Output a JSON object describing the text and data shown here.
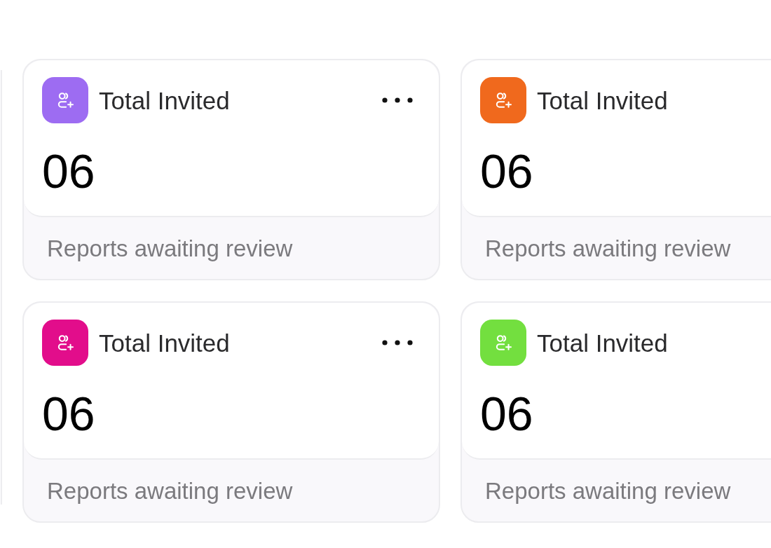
{
  "cards": [
    {
      "title": "Total Invited",
      "value": "06",
      "caption": "Reports awaiting review",
      "color": "#9d6cf2",
      "more_menu": true
    },
    {
      "title": "Total Invited",
      "value": "06",
      "caption": "Reports awaiting review",
      "color": "#f0691d",
      "more_menu": false
    },
    {
      "title": "Total Invited",
      "value": "06",
      "caption": "Reports awaiting review",
      "color": "#e20d8b",
      "more_menu": true
    },
    {
      "title": "Total Invited",
      "value": "06",
      "caption": "Reports awaiting review",
      "color": "#73df3f",
      "more_menu": false
    }
  ]
}
